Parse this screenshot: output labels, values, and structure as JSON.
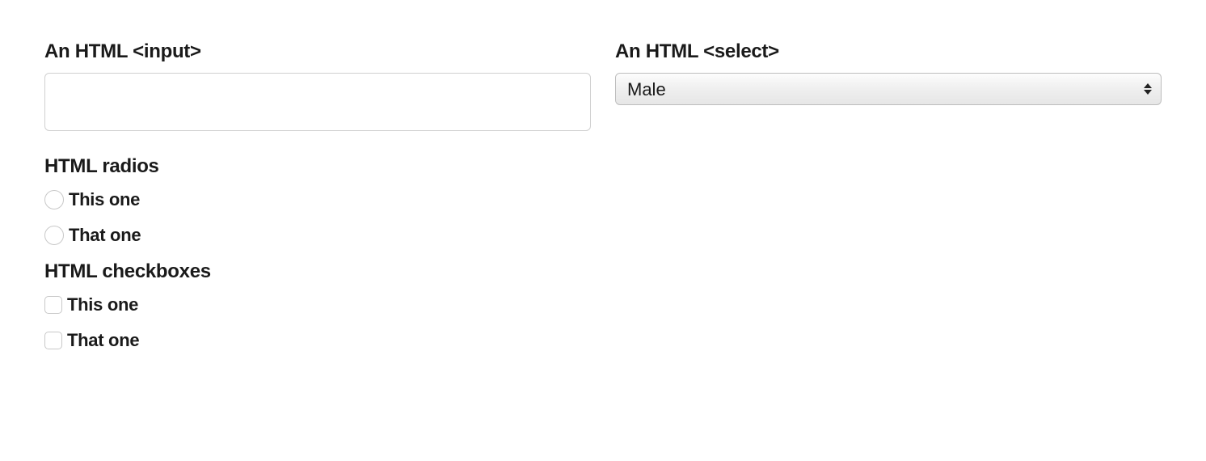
{
  "input_section": {
    "label": "An HTML <input>",
    "value": ""
  },
  "select_section": {
    "label": "An HTML <select>",
    "selected": "Male"
  },
  "radios": {
    "title": "HTML radios",
    "options": [
      {
        "label": "This one"
      },
      {
        "label": "That one"
      }
    ]
  },
  "checkboxes": {
    "title": "HTML checkboxes",
    "options": [
      {
        "label": "This one"
      },
      {
        "label": "That one"
      }
    ]
  }
}
